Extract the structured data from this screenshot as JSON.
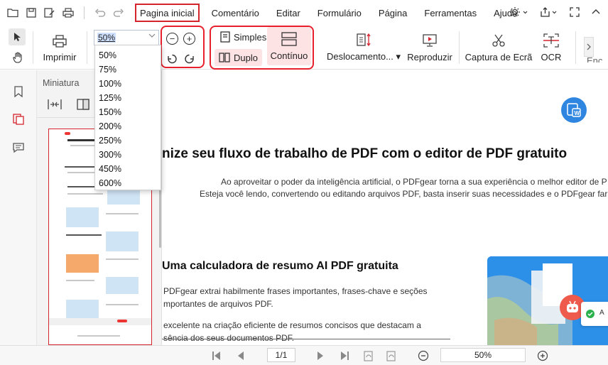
{
  "menu": {
    "items": [
      "Pagina inicial",
      "Comentário",
      "Editar",
      "Formulário",
      "Página",
      "Ferramentas",
      "Ajuda"
    ],
    "active": "Pagina inicial"
  },
  "ribbon": {
    "print_label": "Imprimir",
    "zoom_value": "50%",
    "simple_label": "Simples",
    "double_label": "Duplo",
    "continuous_label": "Contínuo",
    "scroll_label": "Deslocamento...",
    "play_label": "Reproduzir",
    "capture_label": "Captura de Ecrã",
    "ocr_label": "OCR",
    "more_label": "Enc"
  },
  "zoom_options": [
    "50%",
    "75%",
    "100%",
    "125%",
    "150%",
    "200%",
    "250%",
    "300%",
    "450%",
    "600%"
  ],
  "thumbnail_panel": {
    "title": "Miniatura"
  },
  "document": {
    "heading": "nize seu fluxo de trabalho de PDF com o editor de PDF gratuito",
    "intro_line1": "Ao aproveitar o poder da inteligência artificial, o PDFgear torna a sua experiência o melhor editor de P",
    "intro_line2": "Esteja você lendo, convertendo ou editando arquivos PDF, basta inserir suas necessidades e o PDFgear fará o",
    "section_heading": "Uma calculadora de resumo AI PDF gratuita",
    "para1_line1": "PDFgear extrai habilmente frases importantes, frases-chave e seções",
    "para1_line2": "mportantes de arquivos PDF.",
    "para2_line1": "excelente na criação eficiente de resumos concisos que destacam a",
    "para2_line2": "sência dos seus documentos PDF.",
    "word_icon_text": "W",
    "toast_text": "A"
  },
  "bottom": {
    "page_indicator": "1/1",
    "zoom_value": "50%"
  },
  "colors": {
    "accent": "#d4252e",
    "highlight_box": "#e8202b",
    "word_blue": "#2f86e0",
    "hero_blue": "#2c8fe8",
    "bot_red": "#ee5a4c"
  }
}
